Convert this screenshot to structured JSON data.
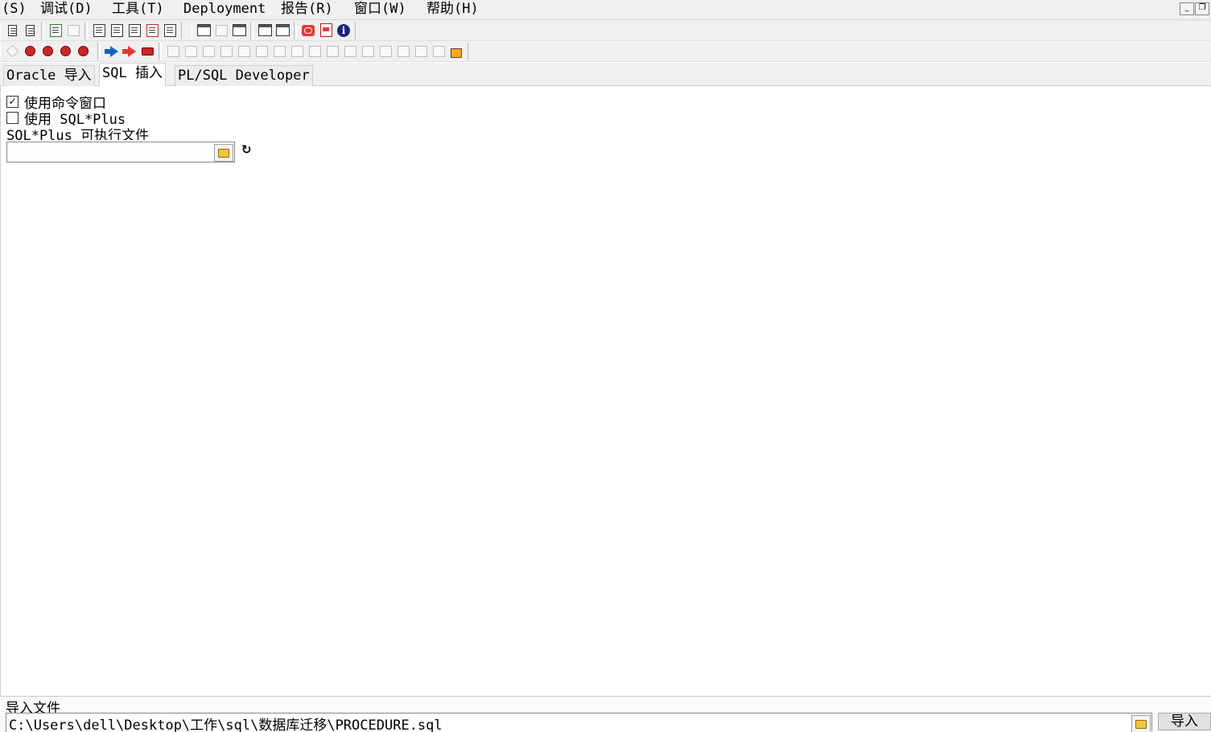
{
  "menu": {
    "items": [
      "(S)",
      "调试(D)",
      "工具(T)",
      "Deployment",
      "报告(R)",
      "窗口(W)",
      "帮助(H)"
    ]
  },
  "tabs": [
    "Oracle 导入",
    "SQL 插入",
    "PL/SQL Developer"
  ],
  "active_tab": "SQL 插入",
  "options": {
    "use_command_window": {
      "label": "使用命令窗口",
      "checked": true,
      "mark": "✓"
    },
    "use_sqlplus": {
      "label": "使用 SQL*Plus",
      "checked": false,
      "mark": ""
    }
  },
  "sqlplus_exe": {
    "label": "SQL*Plus 可执行文件",
    "value": ""
  },
  "import_file": {
    "label": "导入文件",
    "value": "C:\\Users\\dell\\Desktop\\工作\\sql\\数据库迁移\\PROCEDURE.sql"
  },
  "import_button": "导入",
  "icons": {
    "refresh": "↻",
    "minimize": "_",
    "restore": "❐",
    "close": "×"
  }
}
